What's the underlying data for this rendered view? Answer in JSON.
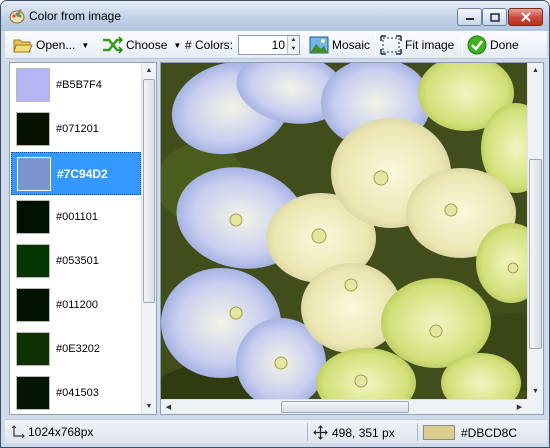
{
  "window": {
    "title": "Color from image"
  },
  "toolbar": {
    "open_label": "Open...",
    "choose_label": "Choose",
    "colors_label": "# Colors:",
    "colors_value": "10",
    "mosaic_label": "Mosaic",
    "fit_label": "Fit image",
    "done_label": "Done"
  },
  "swatches": [
    {
      "hex": "#B5B7F4",
      "color": "#B5B7F4",
      "selected": false
    },
    {
      "hex": "#071201",
      "color": "#071201",
      "selected": false
    },
    {
      "hex": "#7C94D2",
      "color": "#7C94D2",
      "selected": true
    },
    {
      "hex": "#001101",
      "color": "#001101",
      "selected": false
    },
    {
      "hex": "#053501",
      "color": "#053501",
      "selected": false
    },
    {
      "hex": "#011200",
      "color": "#011200",
      "selected": false
    },
    {
      "hex": "#0E3202",
      "color": "#0E3202",
      "selected": false
    },
    {
      "hex": "#041503",
      "color": "#041503",
      "selected": false
    }
  ],
  "status": {
    "image_size": "1024x768px",
    "cursor_pos": "498, 351 px",
    "picked_color_hex": "#DBCD8C",
    "picked_color": "#DBCD8C"
  },
  "icons": {
    "app": "paint-palette-icon",
    "open": "folder-open-icon",
    "choose": "crossed-arrows-icon",
    "mosaic": "landscape-picture-icon",
    "fit": "fit-frame-icon",
    "done": "green-check-icon",
    "size": "resize-corner-icon",
    "cursor": "move-cross-icon"
  }
}
